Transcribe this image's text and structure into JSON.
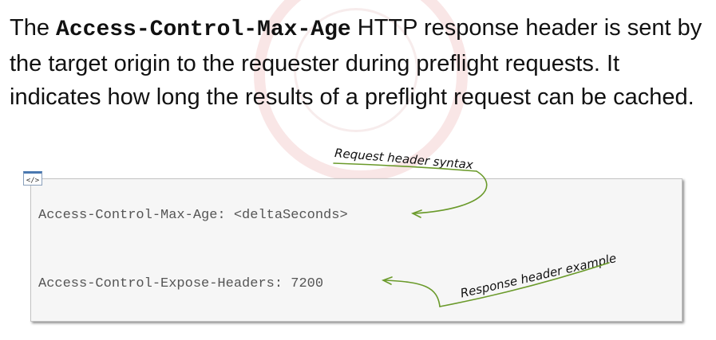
{
  "paragraph": {
    "text_before": "The ",
    "code": "Access-Control-Max-Age",
    "text_after": " HTTP response header is sent by the target origin to the requester during preflight requests. It indicates how long the results of a preflight request can be cached."
  },
  "code_block": {
    "icon": "</>",
    "icon_name": "code-icon",
    "line1": "Access-Control-Max-Age: <deltaSeconds>",
    "line2": "Access-Control-Expose-Headers: 7200"
  },
  "annotations": {
    "request": "Request header syntax",
    "response": "Response header example"
  },
  "colors": {
    "annotation_arrow": "#6a9a2a",
    "code_text": "#555555",
    "code_background": "#f6f6f6"
  }
}
